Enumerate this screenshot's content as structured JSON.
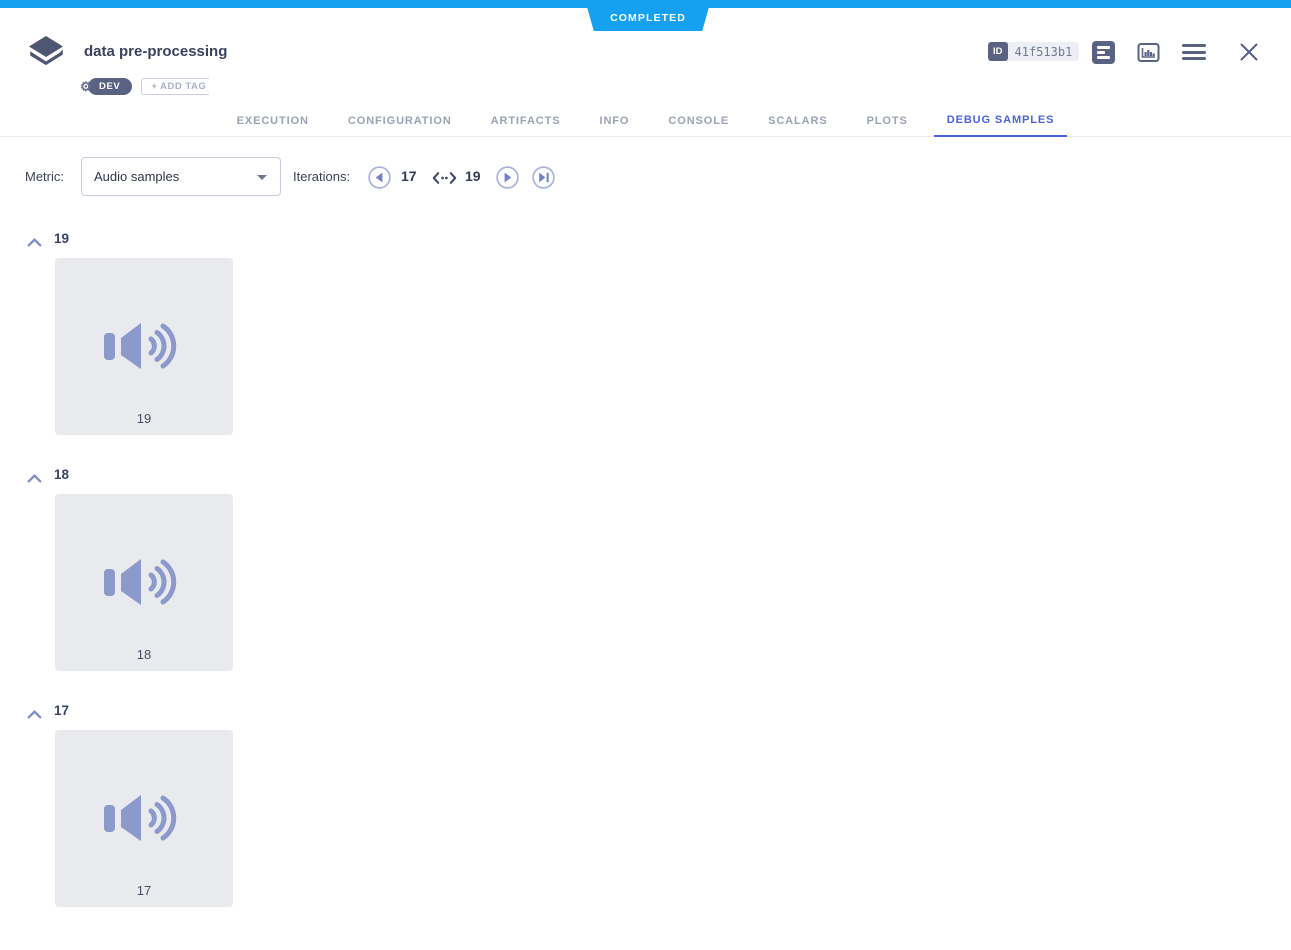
{
  "status": {
    "label": "COMPLETED"
  },
  "header": {
    "title": "data pre-processing",
    "tags": [
      {
        "label": "DEV"
      }
    ],
    "add_tag": "+ ADD TAG",
    "id_badge": "ID",
    "id_value": "41f513b1"
  },
  "tabs": [
    {
      "label": "EXECUTION",
      "active": false
    },
    {
      "label": "CONFIGURATION",
      "active": false
    },
    {
      "label": "ARTIFACTS",
      "active": false
    },
    {
      "label": "INFO",
      "active": false
    },
    {
      "label": "CONSOLE",
      "active": false
    },
    {
      "label": "SCALARS",
      "active": false
    },
    {
      "label": "PLOTS",
      "active": false
    },
    {
      "label": "DEBUG SAMPLES",
      "active": true
    }
  ],
  "controls": {
    "metric_label": "Metric:",
    "metric_value": "Audio samples",
    "iterations_label": "Iterations:",
    "range_start": "17",
    "range_end": "19"
  },
  "sections": [
    {
      "iteration": "19",
      "sample_caption": "19",
      "sample_type": "audio"
    },
    {
      "iteration": "18",
      "sample_caption": "18",
      "sample_type": "audio"
    },
    {
      "iteration": "17",
      "sample_caption": "17",
      "sample_type": "audio"
    }
  ],
  "icons": {
    "app": "graduation-cap",
    "tag_gear": "gear",
    "details_view": "list-lines",
    "plots_view": "histogram-frame",
    "menu": "hamburger",
    "close": "x",
    "metric_caret": "caret-down",
    "prev_iteration": "circle-triangle-left",
    "next_iteration": "circle-triangle-right",
    "last_iteration": "circle-triangle-bar-right",
    "iteration_range": "double-headed-dotted-arrow",
    "collapse_section": "chevron-up",
    "audio_sample": "speaker-with-waves"
  },
  "colors": {
    "status_completed": "#16A0F0",
    "accent_tab": "#4A62DC",
    "slate_icon": "#5A6284",
    "periwinkle_icon": "#8B99CB",
    "card_background": "#E9EAEE"
  }
}
